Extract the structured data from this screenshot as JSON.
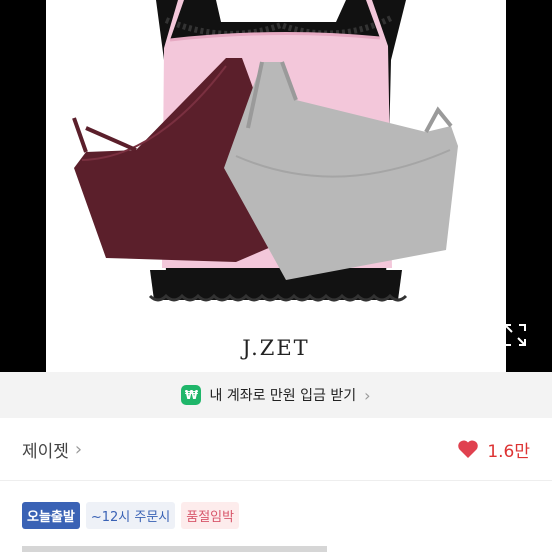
{
  "product": {
    "image_alt": "Camisole tops in pink, burgundy and grey with black lace",
    "brand_text": "J.ZET"
  },
  "promo": {
    "icon": "won-icon",
    "label": "내 계좌로 만원 입금 받기"
  },
  "seller": {
    "name": "제이젯",
    "likes": "1.6만"
  },
  "badges": [
    "오늘출발",
    "~12시 주문시",
    "품절임박"
  ],
  "colors": {
    "accent_green": "#1fb66a",
    "like_red": "#e0414f",
    "badge_blue": "#3a62b5",
    "badge_pink_text": "#d8576b"
  }
}
